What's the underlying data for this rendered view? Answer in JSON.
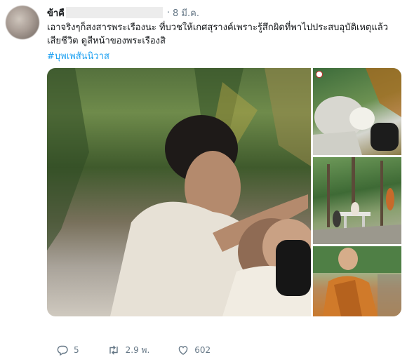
{
  "tweet": {
    "author_name": "ข้าคื",
    "separator": "·",
    "date": "8 มี.ค.",
    "text": "เอาจริงๆก็สงสารพระเรืองนะ ที่บวชให้เกศสุรางค์เพราะรู้สึกผิดที่พาไปประสบอุบัติเหตุแล้วเสียชีวิต ดูสีหน้าของพระเรืองสิ",
    "hashtag": "#บุพเพสันนิวาส"
  },
  "actions": {
    "reply_count": "5",
    "retweet_count": "2.9 พ.",
    "like_count": "602"
  },
  "icons": {
    "reply": "reply-icon",
    "retweet": "retweet-icon",
    "like": "heart-icon"
  },
  "colors": {
    "hashtag": "#1da1f2",
    "meta": "#657786",
    "text": "#14171a"
  }
}
